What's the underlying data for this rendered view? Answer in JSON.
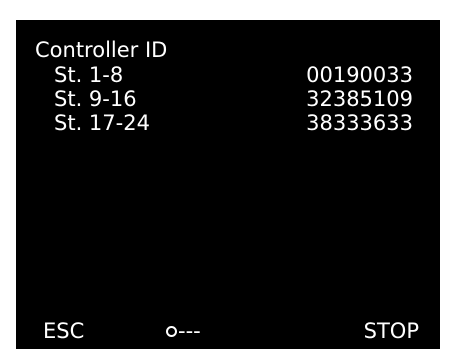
{
  "title": "Controller ID",
  "rows": [
    {
      "label": "St. 1-8",
      "value": "00190033"
    },
    {
      "label": "St. 9-16",
      "value": "32385109"
    },
    {
      "label": "St. 17-24",
      "value": "38333633"
    }
  ],
  "footer": {
    "left": "ESC",
    "middle": "---",
    "middle_icon": "circle-icon",
    "right": "STOP"
  },
  "colors": {
    "screen_background": "#000000",
    "text": "#ffffff",
    "bezel": "#ffffff"
  }
}
